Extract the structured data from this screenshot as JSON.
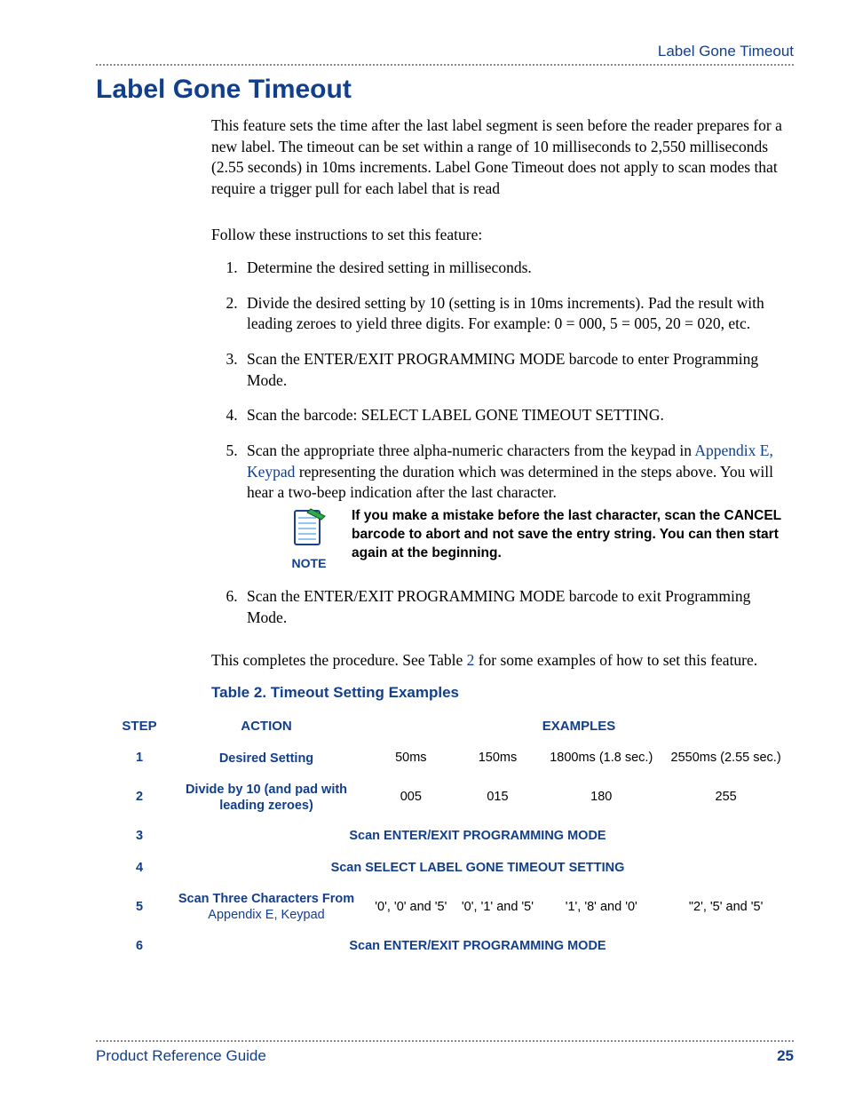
{
  "header": {
    "running": "Label Gone Timeout"
  },
  "title": "Label Gone Timeout",
  "intro": "This feature sets the time after the last label segment is seen before the reader prepares for a new label. The timeout can be set within a range of 10 milliseconds to 2,550 milliseconds (2.55 seconds) in 10ms increments. Label Gone Timeout does not apply to scan modes that require a trigger pull for each label that is read",
  "follow": "Follow these instructions to set this feature:",
  "steps": {
    "s1": "Determine the desired setting in milliseconds.",
    "s2": "Divide the desired setting by 10 (setting is in 10ms increments). Pad the result with leading zeroes to yield three digits. For example: 0 = 000, 5 = 005, 20 = 020, etc.",
    "s3": "Scan the ENTER/EXIT PROGRAMMING MODE barcode to enter Programming Mode.",
    "s4": "Scan the barcode: SELECT LABEL GONE TIMEOUT SETTING.",
    "s5a": "Scan the appropriate three alpha-numeric characters from the keypad in ",
    "s5link": "Appendix E, Keypad",
    "s5b": " representing the duration which was determined in the steps above. You will hear a two-beep indication after the last character.",
    "s6": "Scan the ENTER/EXIT PROGRAMMING MODE barcode to exit Programming Mode."
  },
  "note": {
    "label": "NOTE",
    "text": "If you make a mistake before the last character, scan the CANCEL barcode to abort and not save the entry string. You can then start again at the beginning."
  },
  "closinga": "This completes the procedure. See Table ",
  "closinglink": "2",
  "closingb": " for some examples of how to set this feature.",
  "table": {
    "caption": "Table 2. Timeout Setting Examples",
    "head_step": "STEP",
    "head_action": "ACTION",
    "head_examples": "EXAMPLES",
    "rows": {
      "r1": {
        "num": "1",
        "action": "Desired Setting",
        "c1": "50ms",
        "c2": "150ms",
        "c3": "1800ms (1.8 sec.)",
        "c4": "2550ms (2.55 sec.)"
      },
      "r2": {
        "num": "2",
        "action": "Divide by 10 (and pad with leading zeroes)",
        "c1": "005",
        "c2": "015",
        "c3": "180",
        "c4": "255"
      },
      "r3": {
        "num": "3",
        "span": "Scan ENTER/EXIT PROGRAMMING MODE"
      },
      "r4": {
        "num": "4",
        "span": "Scan SELECT LABEL GONE TIMEOUT SETTING"
      },
      "r5": {
        "num": "5",
        "action_a": "Scan Three Characters From ",
        "action_link": "Appendix E, Keypad",
        "c1": "'0', '0' and '5'",
        "c2": "'0', '1' and '5'",
        "c3": "'1', '8' and '0'",
        "c4": "\"2', '5' and '5'"
      },
      "r6": {
        "num": "6",
        "span": "Scan ENTER/EXIT PROGRAMMING MODE"
      }
    }
  },
  "footer": {
    "left": "Product Reference Guide",
    "right": "25"
  }
}
